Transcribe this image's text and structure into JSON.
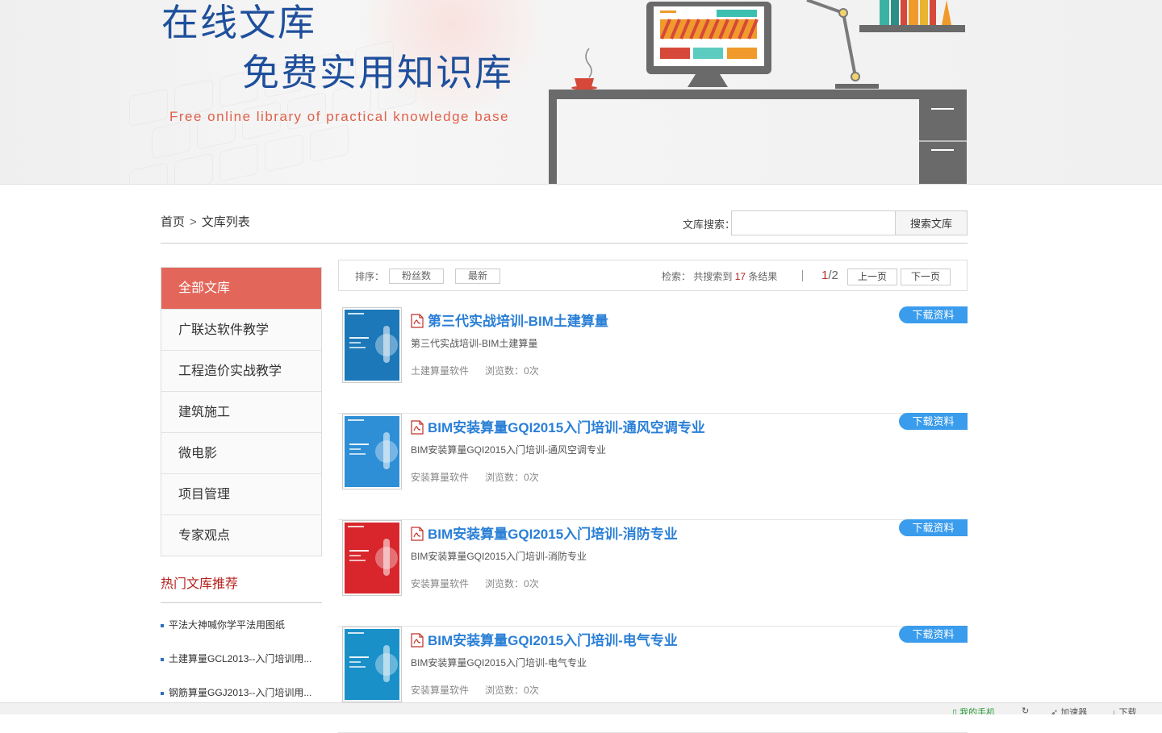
{
  "banner": {
    "title_line1": "在线文库",
    "title_line2": "免费实用知识库",
    "subtitle": "Free online library of practical knowledge base"
  },
  "breadcrumb": {
    "home": "首页",
    "separator": ">",
    "current": "文库列表"
  },
  "search": {
    "label": "文库搜索：",
    "value": "",
    "placeholder": "",
    "button": "搜索文库"
  },
  "sidebar": {
    "items": [
      {
        "label": "全部文库",
        "active": true
      },
      {
        "label": "广联达软件教学"
      },
      {
        "label": "工程造价实战教学"
      },
      {
        "label": "建筑施工"
      },
      {
        "label": "微电影"
      },
      {
        "label": "项目管理"
      },
      {
        "label": "专家观点"
      }
    ],
    "hot_title": "热门文库推荐",
    "hot_items": [
      "平法大神喊你学平法用图纸",
      "土建算量GCL2013--入门培训用...",
      "钢筋算量GGJ2013--入门培训用..."
    ]
  },
  "toolbar": {
    "sort_label": "排序：",
    "sort_fans": "粉丝数",
    "sort_latest": "最新",
    "result_prefix": "检索：  共搜索到",
    "result_count": "17",
    "result_suffix": "条结果",
    "page_current": "1",
    "page_total": "/2",
    "prev": "上一页",
    "next": "下一页"
  },
  "documents": [
    {
      "title": "第三代实战培训-BIM土建算量",
      "desc": "第三代实战培训-BIM土建算量",
      "category": "土建算量软件",
      "views": "浏览数：0次",
      "download": "下载资料",
      "thumb_color": "#1c78b8",
      "icon": "pdf-icon"
    },
    {
      "title": "BIM安装算量GQI2015入门培训-通风空调专业",
      "desc": "BIM安装算量GQI2015入门培训-通风空调专业",
      "category": "安装算量软件",
      "views": "浏览数：0次",
      "download": "下载资料",
      "thumb_color": "#2e8fd6",
      "icon": "pdf-icon"
    },
    {
      "title": "BIM安装算量GQI2015入门培训-消防专业",
      "desc": "BIM安装算量GQI2015入门培训-消防专业",
      "category": "安装算量软件",
      "views": "浏览数：0次",
      "download": "下载资料",
      "thumb_color": "#d8262c",
      "icon": "pdf-icon"
    },
    {
      "title": "BIM安装算量GQI2015入门培训-电气专业",
      "desc": "BIM安装算量GQI2015入门培训-电气专业",
      "category": "安装算量软件",
      "views": "浏览数：0次",
      "download": "下载资料",
      "thumb_color": "#1a90c8",
      "icon": "pdf-icon"
    }
  ],
  "statusbar": {
    "phone": "我的手机",
    "accelerator": "加速器",
    "download": "下载"
  },
  "colors": {
    "accent_red": "#e2675a",
    "link_blue": "#2a7fd6",
    "download_blue": "#3a9cec",
    "hot_red": "#b5211d"
  }
}
